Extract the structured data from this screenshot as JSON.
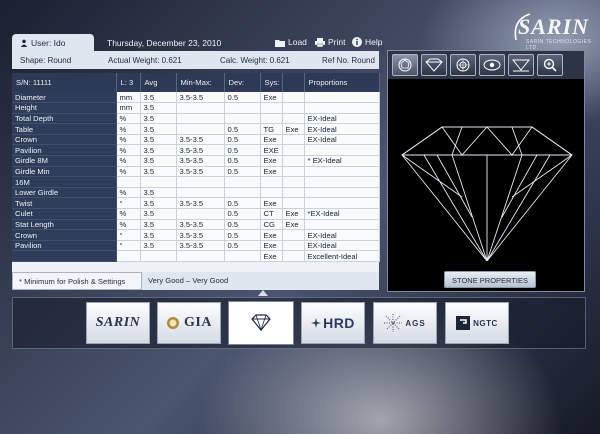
{
  "logo": {
    "word": "SARIN",
    "sub": "SARIN TECHNOLOGIES LTD."
  },
  "topbar": {
    "user_label": "User: Ido",
    "date": "Thursday, December  23, 2010",
    "load": "Load",
    "print": "Print",
    "help": "Help"
  },
  "info": {
    "shape": "Shape: Round",
    "actual_weight": "Actual Weight: 0.621",
    "calc_weight": "Calc. Weight: 0.621",
    "ref": "Ref No. Round"
  },
  "table": {
    "headers": [
      "S/N: 11111",
      "L: 3",
      "Avg",
      "Min-Max:",
      "Dev:",
      "Sys:",
      "",
      "Proportions"
    ],
    "rows": [
      [
        "Diameter",
        "mm",
        "3.5",
        "3.5-3.5",
        "0.5",
        "Exe",
        "",
        ""
      ],
      [
        "Height",
        "mm",
        "3.5",
        "",
        "",
        "",
        "",
        ""
      ],
      [
        "Total Depth",
        "%",
        "3.5",
        "",
        "",
        "",
        "",
        "EX-Ideal"
      ],
      [
        "Table",
        "%",
        "3.5",
        "",
        "0.5",
        "TG",
        "Exe",
        "EX-Ideal"
      ],
      [
        "Crown",
        "%",
        "3.5",
        "3.5-3.5",
        "0.5",
        "Exe",
        "",
        "EX-Ideal"
      ],
      [
        "Pavilion",
        "%",
        "3.5",
        "3.5-3.5",
        "0.5",
        "EXE",
        "",
        ""
      ],
      [
        "Girdle 8M",
        "%",
        "3.5",
        "3.5-3.5",
        "0.5",
        "Exe",
        "",
        "* EX-Ideal"
      ],
      [
        "Girdle Min",
        "%",
        "3.5",
        "3.5-3.5",
        "0.5",
        "Exe",
        "",
        ""
      ],
      [
        "16M",
        "",
        "",
        "",
        "",
        "",
        "",
        ""
      ],
      [
        "Lower Girdle",
        "%",
        "3.5",
        "",
        "",
        "",
        "",
        ""
      ],
      [
        "Twist",
        "°",
        "3.5",
        "3.5-3.5",
        "0.5",
        "Exe",
        "",
        ""
      ],
      [
        "Culet",
        "%",
        "3.5",
        "",
        "0.5",
        "CT",
        "Exe",
        "*EX-Ideal"
      ],
      [
        "Stat Length",
        "%",
        "3.5",
        "3.5-3.5",
        "0.5",
        "CG",
        "Exe",
        ""
      ],
      [
        "Crown",
        "°",
        "3.5",
        "3.5-3.5",
        "0.5",
        "Exe",
        "",
        "EX-Ideal"
      ],
      [
        "Pavilion",
        "°",
        "3.5",
        "3.5-3.5",
        "0.5",
        "Exe",
        "",
        "EX-Ideal"
      ],
      [
        "",
        "",
        "",
        "",
        "",
        "Exe",
        "",
        "Excellent-Ideal"
      ]
    ],
    "footnote": "* Minimum for Polish & Settings",
    "grade": "Very Good – Very Good"
  },
  "viewer": {
    "tools": [
      "crown-view-icon",
      "side-view-icon",
      "table-view-icon",
      "eye-view-icon",
      "pavilion-view-icon",
      "zoom-icon"
    ],
    "stone_properties": "STONE PROPERTIES"
  },
  "labs": [
    {
      "name": "sarin",
      "label": "SARIN"
    },
    {
      "name": "gia",
      "label": "GIA"
    },
    {
      "name": "diamond",
      "label": ""
    },
    {
      "name": "hrd",
      "label": "HRD"
    },
    {
      "name": "ags",
      "label": "AGS"
    },
    {
      "name": "ngtc",
      "label": "NGTC"
    }
  ],
  "colors": {
    "panel_dark": "#2d3a55",
    "panel_light": "#dfe6ef",
    "accent": "#ffffff"
  }
}
